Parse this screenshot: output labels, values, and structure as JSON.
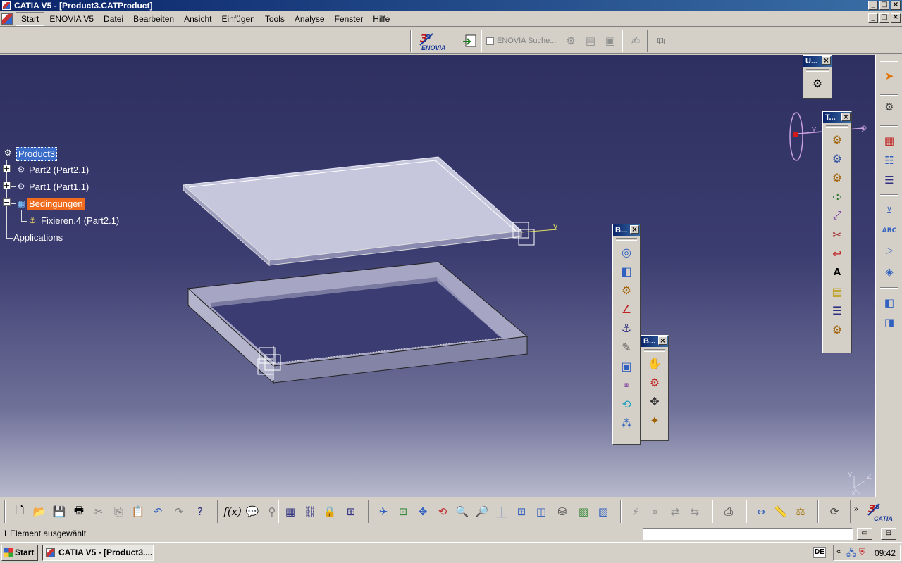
{
  "window": {
    "title": "CATIA V5 - [Product3.CATProduct]"
  },
  "menu": {
    "items": [
      "Start",
      "ENOVIA V5",
      "Datei",
      "Bearbeiten",
      "Ansicht",
      "Einfügen",
      "Tools",
      "Analyse",
      "Fenster",
      "Hilfe"
    ]
  },
  "toptoolbar": {
    "enovia_label": "ENOVIA",
    "enovia_search": "ENOVIA Suche..."
  },
  "tree": {
    "root": "Product3",
    "nodes": [
      "Part2 (Part2.1)",
      "Part1 (Part1.1)",
      "Bedingungen",
      "Fixieren.4 (Part2.1)",
      "Applications"
    ]
  },
  "palettes": {
    "u_title": "U...",
    "t_title": "T...",
    "b1_title": "B...",
    "b2_title": "B..."
  },
  "axis_labels": {
    "y": "y",
    "z": "z",
    "x": "x",
    "compass_y": "Y",
    "compass_z": "Z",
    "compass_x": "X"
  },
  "brand": "CATIA",
  "status": {
    "message": "1 Element ausgewählt",
    "command_value": ""
  },
  "taskbar": {
    "start": "Start",
    "task": "CATIA V5 - [Product3....",
    "lang": "DE",
    "clock": "09:42"
  },
  "colors": {
    "selection_orange": "#f06c1c",
    "selection_blue": "#3a6cc8",
    "title_gradient_start": "#0a246a"
  }
}
